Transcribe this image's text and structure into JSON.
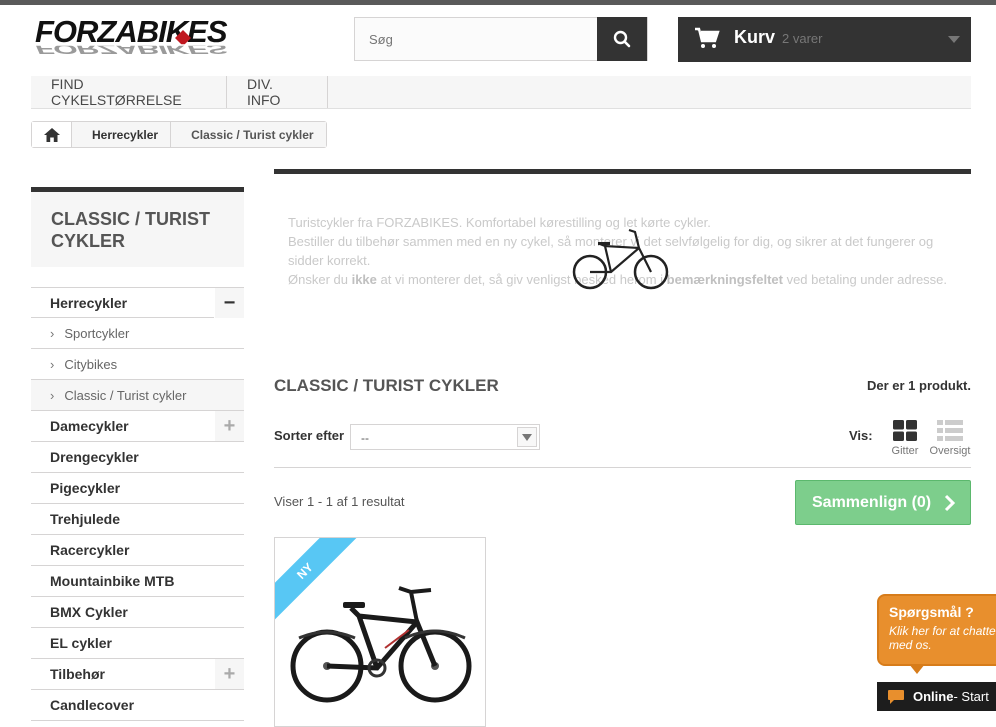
{
  "header": {
    "logo_text": "FORZABIKES",
    "search_placeholder": "Søg",
    "cart_title": "Kurv",
    "cart_count": "2 varer"
  },
  "menu": [
    {
      "label": "FIND CYKELSTØRRELSE"
    },
    {
      "label": "DIV. INFO"
    }
  ],
  "breadcrumb": {
    "items": [
      "Herrecykler",
      "Classic / Turist cykler"
    ]
  },
  "sidebar": {
    "title": "CLASSIC / TURIST CYKLER",
    "categories": [
      {
        "label": "Herrecykler",
        "toggle": "−"
      },
      {
        "label": "Sportcykler"
      },
      {
        "label": "Citybikes"
      },
      {
        "label": "Classic / Turist cykler"
      },
      {
        "label": "Damecykler",
        "toggle": "+"
      },
      {
        "label": "Drengecykler"
      },
      {
        "label": "Pigecykler"
      },
      {
        "label": "Trehjulede"
      },
      {
        "label": "Racercykler"
      },
      {
        "label": "Mountainbike MTB"
      },
      {
        "label": "BMX Cykler"
      },
      {
        "label": "EL cykler"
      },
      {
        "label": "Tilbehør",
        "toggle": "+"
      },
      {
        "label": "Candlecover"
      }
    ]
  },
  "content": {
    "description": {
      "line1": "Turistcykler fra FORZABIKES. Komfortabel kørestilling og let kørte cykler.",
      "line2": "Bestiller du tilbehør sammen med en ny cykel, så monterer vi det selvfølgelig for dig, og sikrer at det fungerer og sidder korrekt.",
      "line3_a": "Ønsker du ",
      "line3_b": "ikke",
      "line3_c": " at vi monterer det, så giv venligst besked herom i ",
      "line3_d": "bemærkningsfeltet",
      "line3_e": " ved betaling under adresse."
    },
    "heading": "CLASSIC / TURIST CYKLER",
    "count_a": "Der er ",
    "count_b": "1",
    "count_c": " produkt.",
    "sort_label": "Sorter efter",
    "sort_value": "--",
    "view_label": "Vis:",
    "view_grid": "Gitter",
    "view_list": "Oversigt",
    "results": "Viser 1 - 1 af 1 resultat",
    "compare_label": "Sammenlign (0)",
    "product_badge": "NY"
  },
  "chat": {
    "title": "Spørgsmål ?",
    "subtitle": "Klik her for at chatte med os.",
    "status": "Online",
    "status_suffix": " - Start"
  }
}
